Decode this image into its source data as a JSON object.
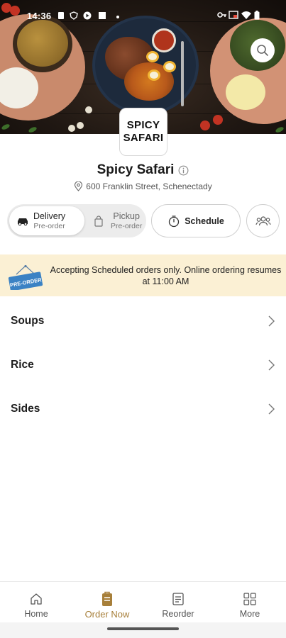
{
  "status_bar": {
    "time": "14:36"
  },
  "restaurant": {
    "logo_line1": "SPICY",
    "logo_line2": "SAFARI",
    "name": "Spicy Safari",
    "address": "600 Franklin Street, Schenectady"
  },
  "order_type": {
    "delivery_label": "Delivery",
    "delivery_sub": "Pre-order",
    "pickup_label": "Pickup",
    "pickup_sub": "Pre-order",
    "selected": "Delivery"
  },
  "schedule_label": "Schedule",
  "banner": {
    "sign_text": "PRE-ORDER",
    "message": "Accepting Scheduled orders only. Online ordering resumes at 11:00 AM"
  },
  "menu": {
    "categories": [
      {
        "label": "Soups"
      },
      {
        "label": "Rice"
      },
      {
        "label": "Sides"
      }
    ]
  },
  "bottom_nav": {
    "items": [
      {
        "label": "Home",
        "icon": "home-icon"
      },
      {
        "label": "Order Now",
        "icon": "order-bag-icon"
      },
      {
        "label": "Reorder",
        "icon": "receipt-icon"
      },
      {
        "label": "More",
        "icon": "grid-icon"
      }
    ],
    "active": "Order Now"
  },
  "colors": {
    "accent": "#a77f3a",
    "banner_bg": "#fbf0d4",
    "preorder_sign": "#3b82c4"
  }
}
